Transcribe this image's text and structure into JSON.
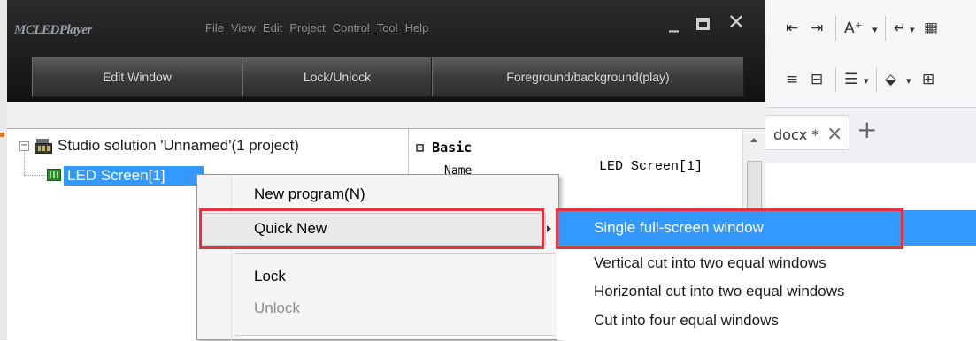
{
  "app": {
    "logo": "MCLEDPlayer",
    "menu": [
      "File",
      "View",
      "Edit",
      "Project",
      "Control",
      "Tool",
      "Help"
    ],
    "window_controls": [
      "_",
      "□",
      "✕"
    ],
    "toolbar": [
      "Edit Window",
      "Lock/Unlock",
      "Foreground/background(play)"
    ]
  },
  "tree": {
    "expander": "−",
    "root_label": "Studio solution 'Unnamed'(1 project)",
    "child_label": "LED Screen[1]"
  },
  "properties": {
    "group_toggle": "⊟",
    "group_label": "Basic",
    "rows": [
      {
        "name": "Name",
        "value": "LED Screen[1]"
      }
    ]
  },
  "context_menu": {
    "items": [
      {
        "label": "New program(N)",
        "enabled": true
      },
      {
        "label": "Quick New",
        "enabled": true,
        "has_submenu": true
      },
      {
        "label": "Lock",
        "enabled": true
      },
      {
        "label": "Unlock",
        "enabled": false
      }
    ]
  },
  "submenu": {
    "items": [
      {
        "label": "Single full-screen window",
        "selected": true
      },
      {
        "label": "Vertical cut into two equal windows",
        "selected": false
      },
      {
        "label": "Horizontal cut into two equal windows",
        "selected": false
      },
      {
        "label": "Cut into four equal windows",
        "selected": false
      }
    ]
  },
  "background_app": {
    "ribbon_row1": [
      "⇤",
      "⇥",
      "A⁺",
      "▾",
      "↵",
      "▾",
      "▦"
    ],
    "ribbon_row2": [
      "≡",
      "⊟",
      "☰",
      "▾",
      "⬙",
      "▾",
      "⊞"
    ],
    "tab_label": "docx *",
    "tab_close": "×",
    "new_tab": "+"
  },
  "colors": {
    "highlight_red": "#e5323e",
    "selection_blue": "#3399ff"
  }
}
